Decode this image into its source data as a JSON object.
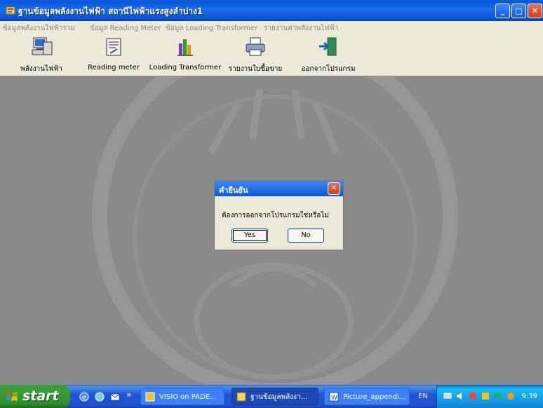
{
  "window": {
    "title": "ฐานข้อมูลพลังงานไฟฟ้า สถานีไฟฟ้าแรงสูงลำปาง1",
    "minimize_label": "_",
    "maximize_label": "□",
    "close_label": "✕"
  },
  "menu": {
    "items": [
      {
        "label": "ข้อมูลพลังงานไฟฟ้ารวม"
      },
      {
        "label": "ข้อมูล Reading Meter"
      },
      {
        "label": "ข้อมูล Loading Transformer"
      },
      {
        "label": "รายงานค่าพลังงานไฟฟ้า"
      }
    ]
  },
  "toolbar": {
    "items": [
      {
        "label": "พลังงานไฟฟ้า",
        "icon": "computer-data-icon"
      },
      {
        "label": "Reading meter",
        "icon": "meter-icon"
      },
      {
        "label": "Loading Transformer",
        "icon": "bar-chart-icon"
      },
      {
        "label": "รายงานใบซื้อขาย",
        "icon": "printer-icon"
      },
      {
        "label": "ออกจากโปรแกรม",
        "icon": "exit-icon"
      }
    ]
  },
  "dialog": {
    "title": "คำยืนยัน",
    "message": "ต้องการออกจากโปรแกรมใช่หรือไม่",
    "yes_label": "Yes",
    "no_label": "No",
    "close_label": "✕"
  },
  "taskbar": {
    "start_label": "start",
    "chevron": "»",
    "tasks": [
      {
        "label": "VISIO on PADE...",
        "icon": "visio-icon"
      },
      {
        "label": "ฐานข้อมูลพลังงา...",
        "icon": "database-app-icon"
      },
      {
        "label": "Picture_appendi...",
        "icon": "word-icon"
      }
    ],
    "language": "EN",
    "clock": "9:39"
  },
  "colors": {
    "titlebar": "#0b56d8",
    "client_background": "#8a8a8a",
    "dialog_face": "#ece9d8",
    "taskbar": "#2157d7",
    "start_button": "#3b9f3b"
  }
}
